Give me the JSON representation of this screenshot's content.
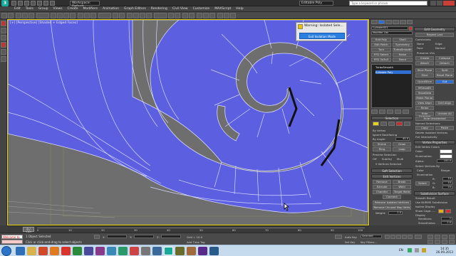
{
  "app": {
    "logo": "3",
    "workspace": "Workspace: Default",
    "title_right_field": "Editable Poly",
    "search_placeholder": "Type a keyword or phrase"
  },
  "menu": [
    "Edit",
    "Tools",
    "Group",
    "Views",
    "Create",
    "Modifiers",
    "Animation",
    "Graph Editors",
    "Rendering",
    "Civil View",
    "Customize",
    "MAXScript",
    "Help"
  ],
  "viewport": {
    "label": "[+] [Perspective] [Shaded + Edged Faces]",
    "mesh_color": "#5b5fe0",
    "background": "#6e6e6e"
  },
  "warning": {
    "title": "Warning: Isolated Sele...",
    "button": "Exit Isolation Mode"
  },
  "command_panel": {
    "tabs": [
      "create",
      "modify",
      "hierarchy",
      "motion",
      "display",
      "utilities"
    ],
    "object_name": "Cylinder001",
    "modifier_list": "Modifier List",
    "mod_buttons": [
      "Edit Poly",
      "Shell",
      "Edit Patch",
      "Symmetry",
      "Turn",
      "TurboSmooth",
      "FFD Select",
      "Noise",
      "FFD 3x3x3",
      "Bend"
    ],
    "stack": [
      "TurboSmooth",
      "Editable Poly"
    ],
    "selection": {
      "header": "Selection",
      "by_vertex": "By Vertex",
      "ignore_backfacing": "Ignore Backfacing",
      "by_angle": "By Angle:",
      "angle": "45.0",
      "shrink": "Shrink",
      "grow": "Grow",
      "ring": "Ring",
      "loop": "Loop",
      "preview_selection": "Preview Selection",
      "off": "Off",
      "subobj": "SubObj",
      "multi": "Multi",
      "status": "0 Vertices Selected"
    },
    "soft_selection": "Soft Selection",
    "edit_vertices": {
      "header": "Edit Vertices",
      "buttons": [
        "Remove",
        "Break",
        "Extrude",
        "Weld",
        "Chamfer",
        "Target Weld",
        "Connect"
      ],
      "remove_isolated": "Remove Isolated Vertices",
      "remove_unused": "Remove Unused Map Verts",
      "weight_label": "Weight:",
      "weight": "1.0"
    },
    "edit_geometry": {
      "header": "Edit Geometry",
      "repeat_last": "Repeat Last",
      "constraints": "Constraints",
      "none": "None",
      "edge": "Edge",
      "face": "Face",
      "normal": "Normal",
      "preserve_uvs": "Preserve UVs",
      "create": "Create",
      "collapse": "Collapse",
      "attach": "Attach",
      "detach": "Detach",
      "slice_plane": "Slice Plane",
      "split": "Split",
      "slice": "Slice",
      "reset_plane": "Reset Plane",
      "quickslice": "QuickSlice",
      "cut": "Cut",
      "msmooth": "MSmooth",
      "tessellate": "Tessellate",
      "make_planar": "Make Planar",
      "view_align": "View Align",
      "grid_align": "Grid Align",
      "relax": "Relax",
      "hide_selected": "Hide Selected",
      "unhide_all": "Unhide All",
      "hide_unselected": "Hide Unselected",
      "named_selections": "Named Selections:",
      "copy": "Copy",
      "paste": "Paste",
      "delete_isolated": "Delete Isolated Vertices",
      "full_interactivity": "Full Interactivity"
    },
    "vertex_properties": {
      "header": "Vertex Properties",
      "edit_vertex_colors": "Edit Vertex Colors",
      "color": "Color:",
      "illumination": "Illumination:",
      "alpha": "Alpha:",
      "alpha_value": "100.0",
      "select_vertices_by": "Select Vertices By",
      "color_opt": "Color",
      "illumination_opt": "Illumination",
      "range": "Range:",
      "r": "R:",
      "g": "G:",
      "b": "B:",
      "range_val": "10",
      "select": "Select"
    },
    "subdivision_surface": {
      "header": "Subdivision Surface",
      "smooth_result": "Smooth Result",
      "use_nurms": "Use NURMS Subdivision",
      "isoline_display": "Isoline Display",
      "show_cage": "Show Cage......",
      "display": "Display",
      "iterations_label": "Iterations:",
      "iterations": "1",
      "smoothness_label": "Smoothness:",
      "smoothness": "1.0",
      "render": "Render"
    }
  },
  "timeline": {
    "current": "0 / 100",
    "ticks": [
      "0",
      "10",
      "20",
      "30",
      "40",
      "50",
      "60",
      "70",
      "80",
      "90",
      "100"
    ]
  },
  "status": {
    "script_label": "Welcome to MAX",
    "selection": "1 Object Selected",
    "prompt": "Click or click-and-drag to select objects",
    "x_label": "X:",
    "y_label": "Y:",
    "z_label": "Z:",
    "grid": "Grid = 10.0",
    "auto_key": "Auto Key",
    "set_key": "Set Key",
    "selected": "Selected",
    "key_filters": "Key Filters...",
    "add_time_tag": "Add Time Tag"
  },
  "taskbar": {
    "language": "EN",
    "time": "14:35",
    "date": "26.09.2013"
  }
}
